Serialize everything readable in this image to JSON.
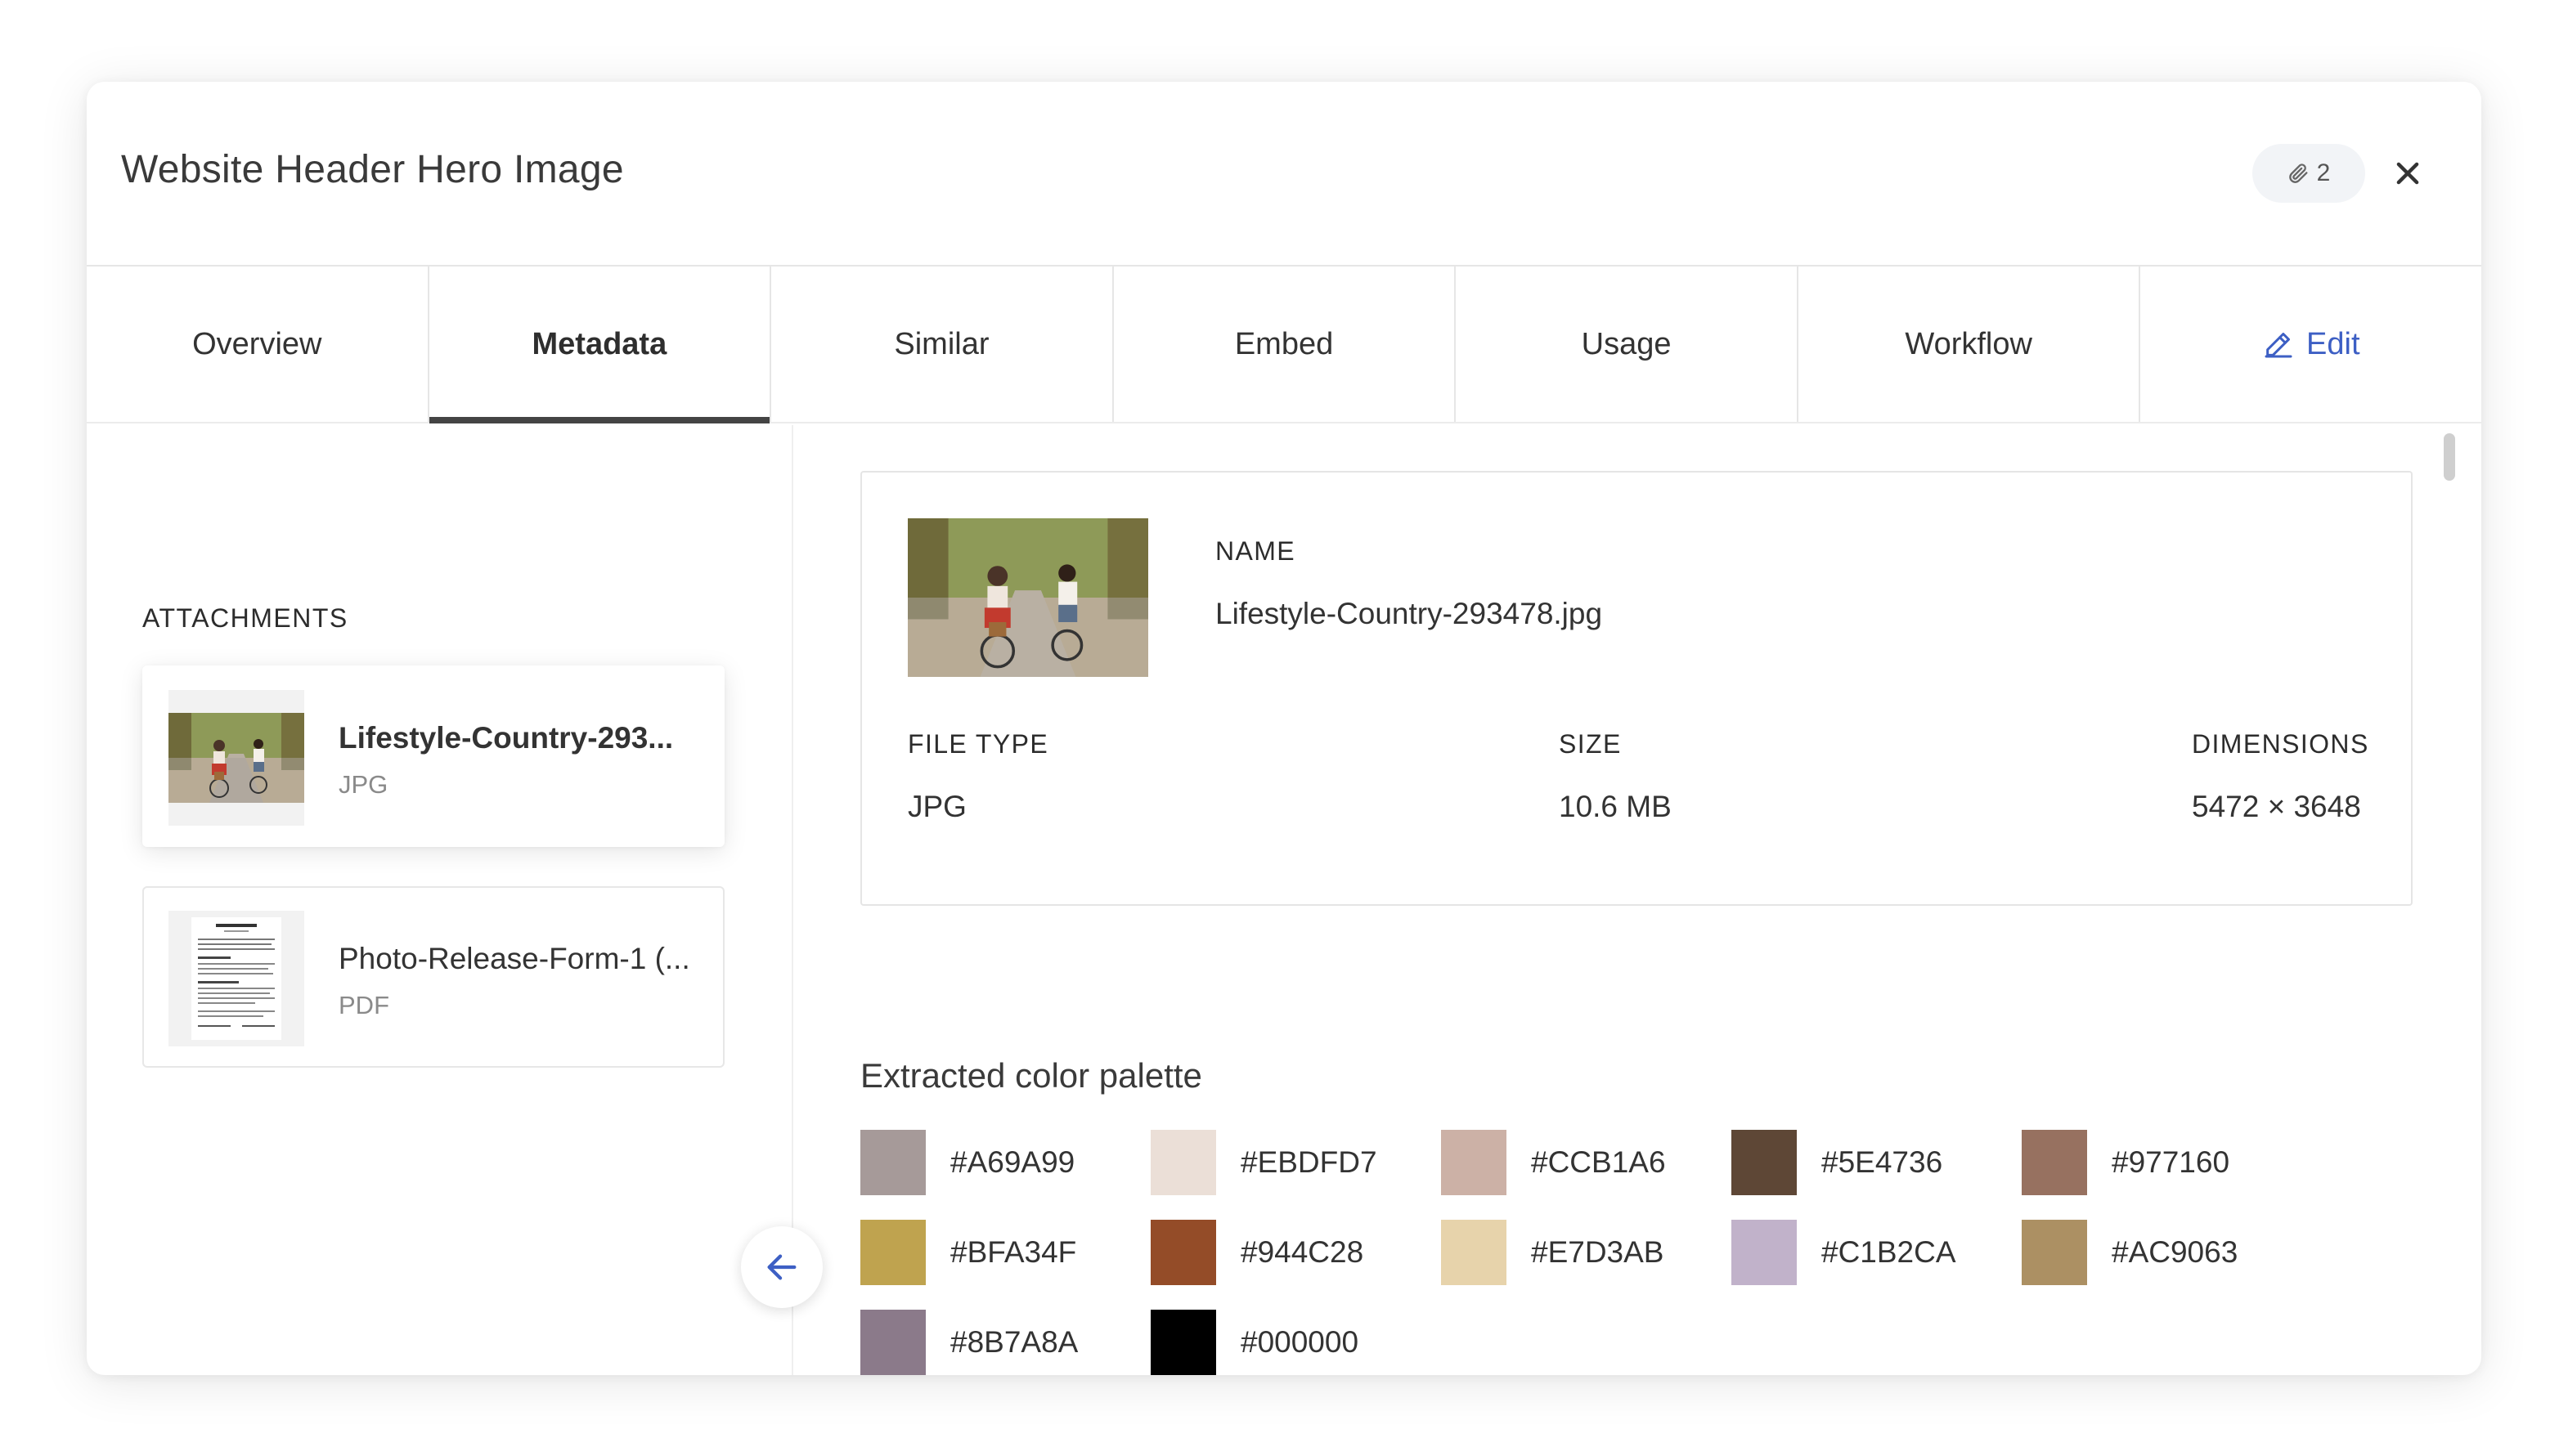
{
  "header": {
    "title": "Website Header Hero Image",
    "attachment_count": "2",
    "attachment_icon": "paperclip-icon",
    "close_icon": "close-icon"
  },
  "tabs": [
    {
      "label": "Overview",
      "active": false
    },
    {
      "label": "Metadata",
      "active": true
    },
    {
      "label": "Similar",
      "active": false
    },
    {
      "label": "Embed",
      "active": false
    },
    {
      "label": "Usage",
      "active": false
    },
    {
      "label": "Workflow",
      "active": false
    },
    {
      "label": "Edit",
      "icon": "pencil-icon",
      "accent": "#3d5fc4"
    }
  ],
  "attachments": {
    "heading": "ATTACHMENTS",
    "items": [
      {
        "name": "Lifestyle-Country-293...",
        "type": "JPG",
        "selected": true
      },
      {
        "name": "Photo-Release-Form-1 (...",
        "type": "PDF",
        "selected": false
      }
    ]
  },
  "details": {
    "name_label": "NAME",
    "name_value": "Lifestyle-Country-293478.jpg",
    "file_type_label": "FILE TYPE",
    "file_type_value": "JPG",
    "size_label": "SIZE",
    "size_value": "10.6 MB",
    "dimensions_label": "DIMENSIONS",
    "dimensions_value": "5472 × 3648"
  },
  "palette": {
    "title": "Extracted color palette",
    "colors": [
      {
        "hex": "#A69A99",
        "label": "#A69A99"
      },
      {
        "hex": "#EBDFD7",
        "label": "#EBDFD7"
      },
      {
        "hex": "#CCB1A6",
        "label": "#CCB1A6"
      },
      {
        "hex": "#5E4736",
        "label": "#5E4736"
      },
      {
        "hex": "#977160",
        "label": "#977160"
      },
      {
        "hex": "#BFA34F",
        "label": "#BFA34F"
      },
      {
        "hex": "#944C28",
        "label": "#944C28"
      },
      {
        "hex": "#E7D3AB",
        "label": "#E7D3AB"
      },
      {
        "hex": "#C1B2CA",
        "label": "#C1B2CA"
      },
      {
        "hex": "#AC9063",
        "label": "#AC9063"
      },
      {
        "hex": "#8B7A8A",
        "label": "#8B7A8A"
      },
      {
        "hex": "#000000",
        "label": "#000000"
      }
    ]
  },
  "collapse_icon": "arrow-left-icon"
}
